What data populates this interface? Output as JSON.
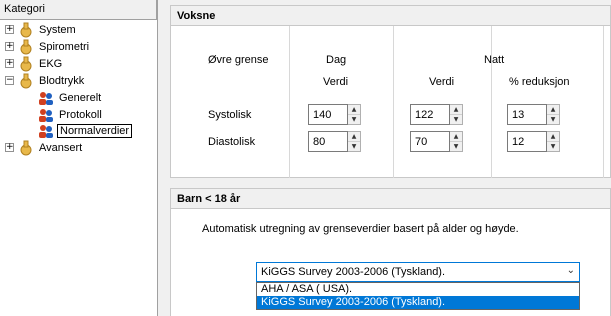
{
  "tree": {
    "header": "Kategori",
    "items": [
      {
        "label": "System"
      },
      {
        "label": "Spirometri"
      },
      {
        "label": "EKG"
      },
      {
        "label": "Blodtrykk"
      },
      {
        "label": "Generelt"
      },
      {
        "label": "Protokoll"
      },
      {
        "label": "Normalverdier"
      },
      {
        "label": "Avansert"
      }
    ]
  },
  "voksne": {
    "title": "Voksne",
    "upper_limit_label": "Øvre grense",
    "day_label": "Dag",
    "night_label": "Natt",
    "verdi_day": "Verdi",
    "verdi_night": "Verdi",
    "reduction_label": "% reduksjon",
    "systolic_label": "Systolisk",
    "diastolic_label": "Diastolisk",
    "systolic": {
      "day": "140",
      "night": "122",
      "reduction": "13"
    },
    "diastolic": {
      "day": "80",
      "night": "70",
      "reduction": "12"
    }
  },
  "barn": {
    "title": "Barn < 18 år",
    "description": "Automatisk utregning av grenseverdier basert på alder og høyde.",
    "selected": "KiGGS Survey 2003-2006 (Tyskland).",
    "options": [
      "AHA / ASA ( USA).",
      "KiGGS Survey 2003-2006 (Tyskland)."
    ]
  },
  "colors": {
    "accent": "#0078d7",
    "folder": "#e8b84a"
  }
}
